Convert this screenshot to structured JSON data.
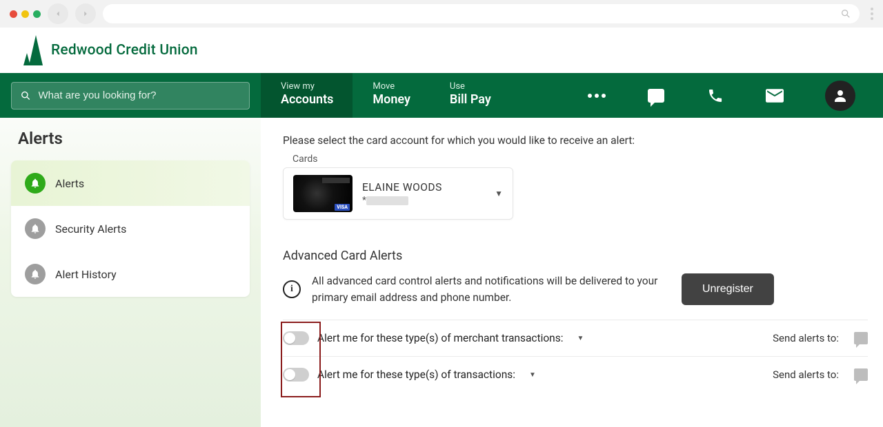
{
  "brand": "Redwood Credit Union",
  "search": {
    "placeholder": "What are you looking for?"
  },
  "nav": {
    "tabs": [
      {
        "pre": "View my",
        "main": "Accounts"
      },
      {
        "pre": "Move",
        "main": "Money"
      },
      {
        "pre": "Use",
        "main": "Bill Pay"
      }
    ]
  },
  "sidebar": {
    "title": "Alerts",
    "items": [
      {
        "label": "Alerts"
      },
      {
        "label": "Security Alerts"
      },
      {
        "label": "Alert History"
      }
    ]
  },
  "content": {
    "instruction": "Please select the card account for which you would like to receive an alert:",
    "cards_label": "Cards",
    "selected_card": {
      "name": "ELAINE WOODS",
      "masked_prefix": "*"
    },
    "advanced": {
      "title": "Advanced Card Alerts",
      "info_text": "All advanced card control alerts and notifications will be delivered to your primary email address and phone number.",
      "unregister_label": "Unregister"
    },
    "alert_rows": [
      {
        "label": "Alert me for these type(s) of merchant transactions:",
        "send_label": "Send alerts to:"
      },
      {
        "label": "Alert me for these type(s) of transactions:",
        "send_label": "Send alerts to:"
      }
    ]
  }
}
